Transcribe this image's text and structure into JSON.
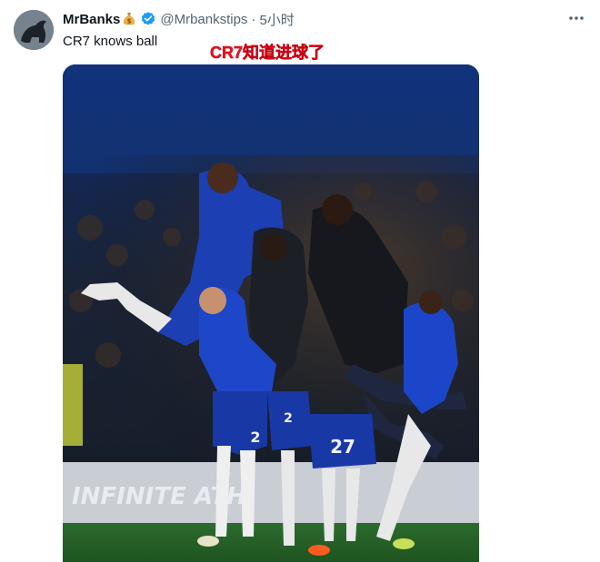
{
  "tweet": {
    "display_name": "MrBanks",
    "name_emoji": "money-bag",
    "handle": "@Mrbankstips",
    "separator": "·",
    "timestamp": "5小时",
    "text": "CR7 knows ball",
    "overlay_caption": "CR7知道进球了",
    "verified_color": "#1d9bf0",
    "caption_color": "#e8121f"
  },
  "media": {
    "description_icon": "football-celebration-photo",
    "board_text": "INFINITE ATH",
    "shirt_numbers": [
      "27",
      "2",
      "2"
    ]
  }
}
